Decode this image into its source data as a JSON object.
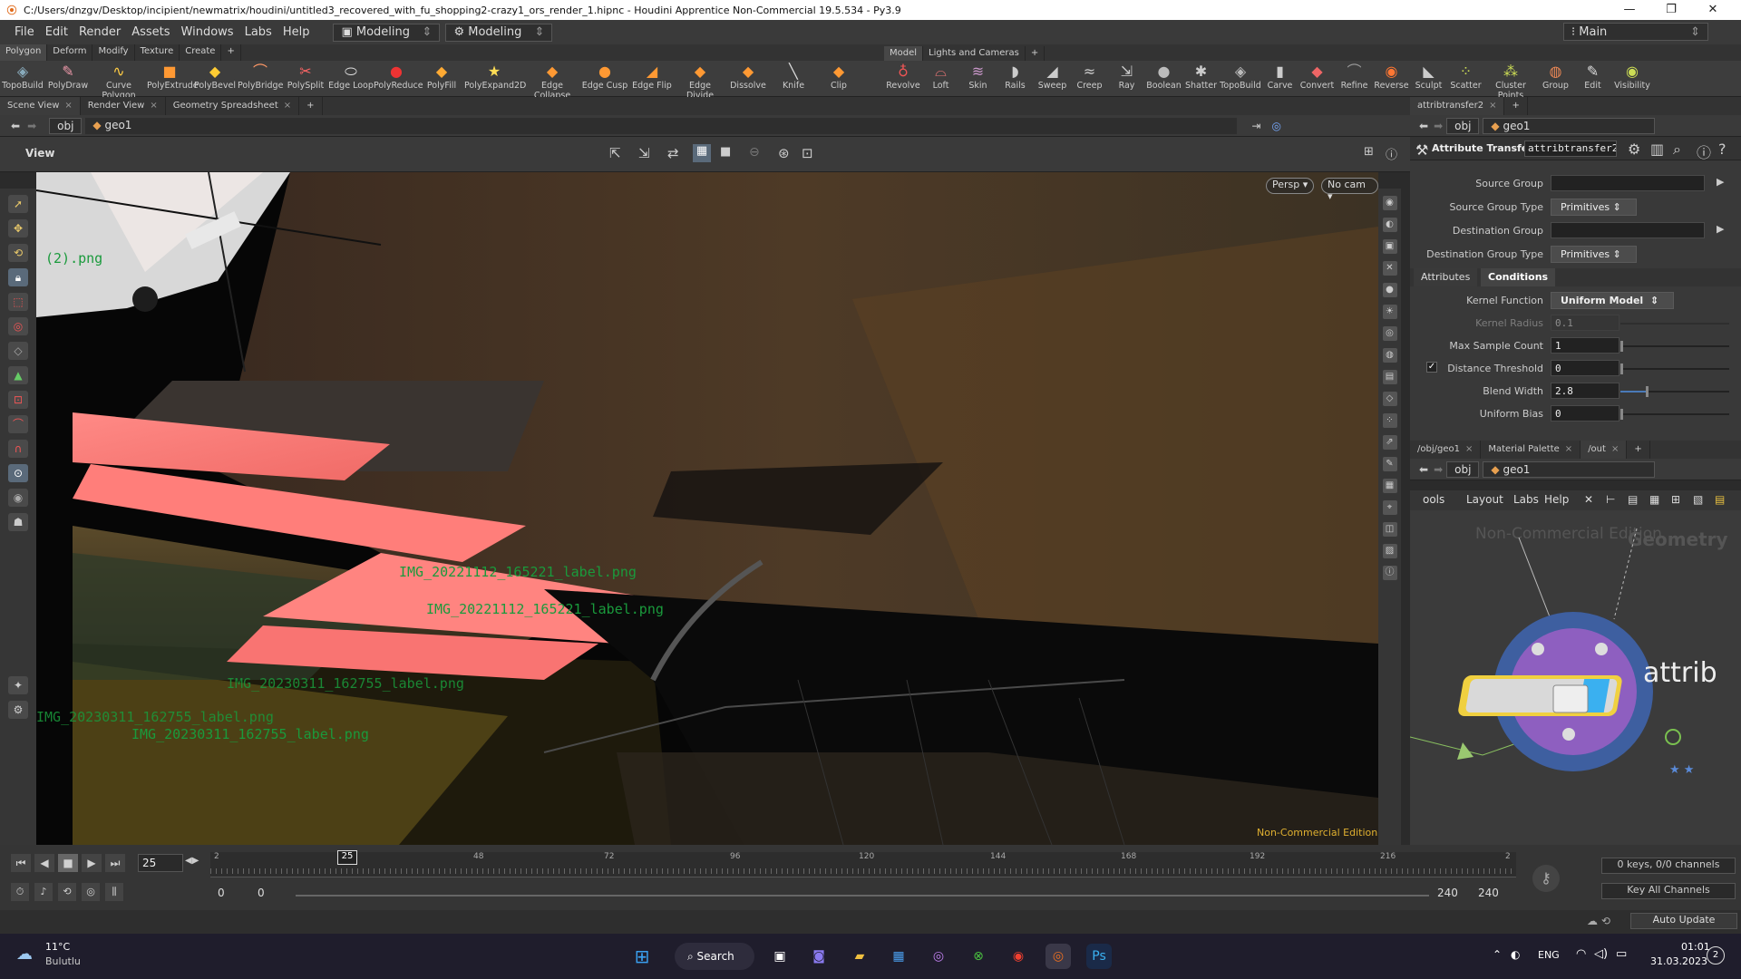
{
  "window": {
    "title": "C:/Users/dnzgv/Desktop/incipient/newmatrix/houdini/untitled3_recovered_with_fu_shopping2-crazy1_ors_render_1.hipnc - Houdini Apprentice Non-Commercial 19.5.534 - Py3.9"
  },
  "menu": {
    "items": [
      "File",
      "Edit",
      "Render",
      "Assets",
      "Windows",
      "Labs",
      "Help"
    ],
    "desktop1": "Modeling",
    "desktop2": "Modeling",
    "desktop_right": "Main"
  },
  "shelf": {
    "tabs_left": [
      "Polygon",
      "Deform",
      "Modify",
      "Texture",
      "Create"
    ],
    "tabs_right": [
      "Model",
      "Lights and Cameras"
    ],
    "tools_left": [
      "TopoBuild",
      "PolyDraw",
      "Curve Polygon",
      "PolyExtrude",
      "PolyBevel",
      "PolyBridge",
      "PolySplit",
      "Edge Loop",
      "PolyReduce",
      "PolyFill",
      "PolyExpand2D",
      "Edge Collapse",
      "Edge Cusp",
      "Edge Flip",
      "Edge Divide",
      "Dissolve",
      "Knife",
      "Clip"
    ],
    "tools_right": [
      "Revolve",
      "Loft",
      "Skin",
      "Rails",
      "Sweep",
      "Creep",
      "Ray",
      "Boolean",
      "Shatter",
      "TopoBuild",
      "Carve",
      "Convert",
      "Refine",
      "Reverse",
      "Sculpt",
      "Scatter",
      "Cluster Points",
      "Group",
      "Edit",
      "Visibility"
    ]
  },
  "viewer": {
    "tabs": [
      "Scene View",
      "Render View",
      "Geometry Spreadsheet"
    ],
    "path_obj": "obj",
    "path_geo": "geo1",
    "label": "View",
    "persp": "Persp",
    "cam": "No cam",
    "watermark": "Non-Commercial Edition",
    "overlay_labels": [
      "(2).png",
      "IMG_20221112_165221_label.png",
      "IMG_20221112_165221_label.png",
      "IMG_20230311_162755_label.png",
      "IMG_20230311_162755_label.png",
      "IMG_20230311_162755_label.png"
    ]
  },
  "params": {
    "tab": "attribtransfer2",
    "path_obj": "obj",
    "path_geo": "geo1",
    "node_type": "Attribute Transfer",
    "node_name": "attribtransfer2",
    "source_group": "Source Group",
    "source_group_type": "Source Group Type",
    "source_group_type_val": "Primitives",
    "dest_group": "Destination Group",
    "dest_group_type": "Destination Group Type",
    "dest_group_type_val": "Primitives",
    "subtabs": [
      "Attributes",
      "Conditions"
    ],
    "kernel_function": "Kernel Function",
    "kernel_function_val": "Uniform Model",
    "kernel_radius": "Kernel Radius",
    "kernel_radius_val": "0.1",
    "max_sample": "Max Sample Count",
    "max_sample_val": "1",
    "dist_thresh": "Distance Threshold",
    "dist_thresh_val": "0",
    "blend_width": "Blend Width",
    "blend_width_val": "2.8",
    "uniform_bias": "Uniform Bias",
    "uniform_bias_val": "0"
  },
  "network": {
    "tabs": [
      "/obj/geo1",
      "Material Palette",
      "/out"
    ],
    "path_obj": "obj",
    "path_geo": "geo1",
    "menu": [
      "ools",
      "Layout",
      "Labs",
      "Help"
    ],
    "watermark": "Non-Commercial Edition",
    "context": "Geometry",
    "node_label": "attrib"
  },
  "timeline": {
    "frame": "25",
    "current_marker": "25",
    "ticks": [
      "2",
      "48",
      "72",
      "96",
      "120",
      "144",
      "168",
      "192",
      "216",
      "2"
    ],
    "start1": "0",
    "start2": "0",
    "end1": "240",
    "end2": "240",
    "keys": "0 keys, 0/0 channels",
    "key_all": "Key All Channels",
    "auto_update": "Auto Update"
  },
  "taskbar": {
    "temp": "11°C",
    "weather": "Bulutlu",
    "search": "Search",
    "lang": "ENG",
    "time": "01:01",
    "date": "31.03.2023",
    "notif": "2"
  }
}
